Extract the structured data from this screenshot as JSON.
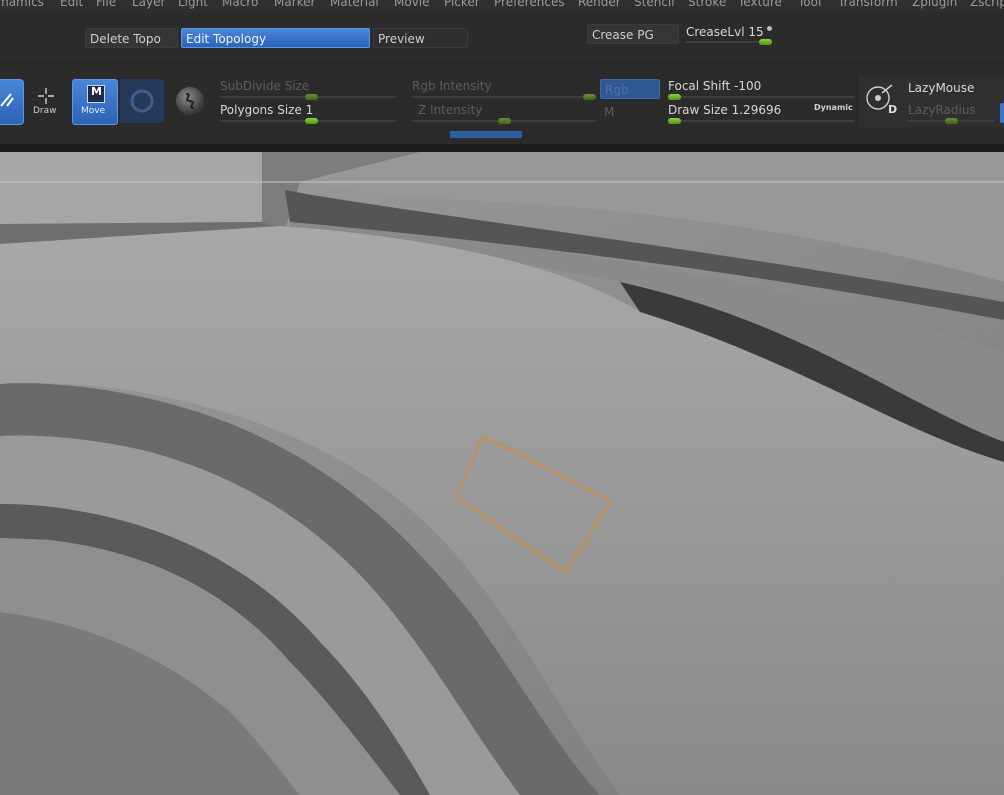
{
  "menu": {
    "items": [
      "ynamics",
      "Edit",
      "File",
      "Layer",
      "Light",
      "Macro",
      "Marker",
      "Material",
      "Movie",
      "Picker",
      "Preferences",
      "Render",
      "Stencil",
      "Stroke",
      "Texture",
      "Tool",
      "Transform",
      "Zplugin",
      "Zscrip"
    ]
  },
  "topology": {
    "delete_topo": "Delete Topo",
    "edit_topology": "Edit Topology",
    "preview": "Preview",
    "crease_pg": "Crease PG",
    "crease_lvl": "CreaseLvl 15"
  },
  "toolbar": {
    "draw_label": "Draw",
    "move_label": "Move",
    "move_badge": "M",
    "subdivide_size": "SubDivide Size",
    "polygons_size": "Polygons Size 1",
    "rgb_intensity": "Rgb Intensity",
    "z_intensity": "Z Intensity",
    "rgb_btn": "Rgb",
    "m_btn": "M",
    "focal_shift": "Focal Shift -100",
    "draw_size": "Draw Size 1.29696",
    "dynamic": "Dynamic",
    "lazymouse": "LazyMouse",
    "lazyradius": "LazyRadius",
    "lazy_icon_letter": "D"
  },
  "sliders": {
    "subdivide_level": 0.52,
    "polygons_level": 0.52,
    "rgb_intensity_level": 1.0,
    "z_intensity_level": 0.5,
    "focal_shift_level": 0.0,
    "draw_size_level": 0.0,
    "lazyradius_level": 0.5,
    "crease_lvl_level": 1.0
  },
  "colors": {
    "accent_blue": "#3a74c8",
    "slider_green": "#6cc02a",
    "selection_orange": "#d98a2b",
    "canvas_gray": "#8e8e8e"
  },
  "icons": [
    "edit-brush-icon",
    "draw-crosshair-icon",
    "move-icon",
    "rotate-icon",
    "sphere-material-icon",
    "lazymouse-icon"
  ]
}
